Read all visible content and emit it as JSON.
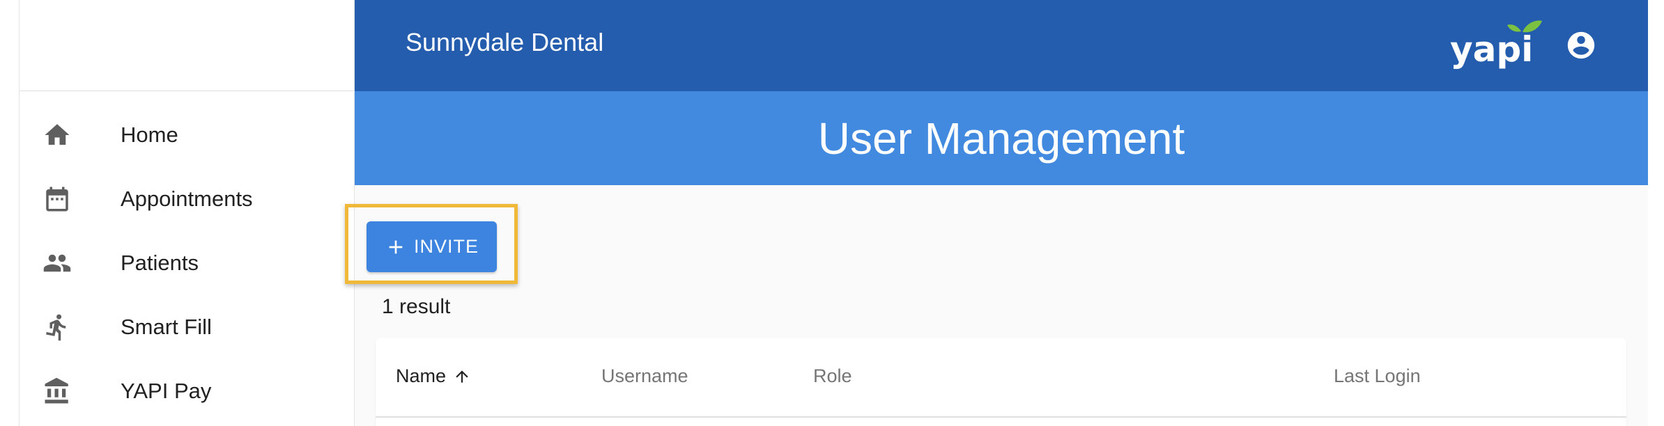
{
  "sidebar": {
    "items": [
      {
        "label": "Home",
        "icon": "home-icon"
      },
      {
        "label": "Appointments",
        "icon": "calendar-icon"
      },
      {
        "label": "Patients",
        "icon": "people-icon"
      },
      {
        "label": "Smart Fill",
        "icon": "running-person-icon"
      },
      {
        "label": "YAPI Pay",
        "icon": "bank-icon"
      }
    ]
  },
  "header": {
    "practice_name": "Sunnydale Dental",
    "logo_text": "yapi",
    "account_icon": "account-circle-icon"
  },
  "page": {
    "title": "User Management"
  },
  "toolbar": {
    "invite_label": "INVITE",
    "invite_icon": "plus-icon"
  },
  "results": {
    "count_text": "1 result"
  },
  "table": {
    "columns": [
      {
        "label": "Name",
        "sorted": "ascending"
      },
      {
        "label": "Username"
      },
      {
        "label": "Role"
      },
      {
        "label": "Last Login"
      }
    ]
  },
  "colors": {
    "header_bg": "#245dae",
    "title_bar_bg": "#418ae0",
    "button_bg": "#3c84df",
    "highlight": "#f0b93a",
    "logo_leaf": "#7cc242"
  }
}
